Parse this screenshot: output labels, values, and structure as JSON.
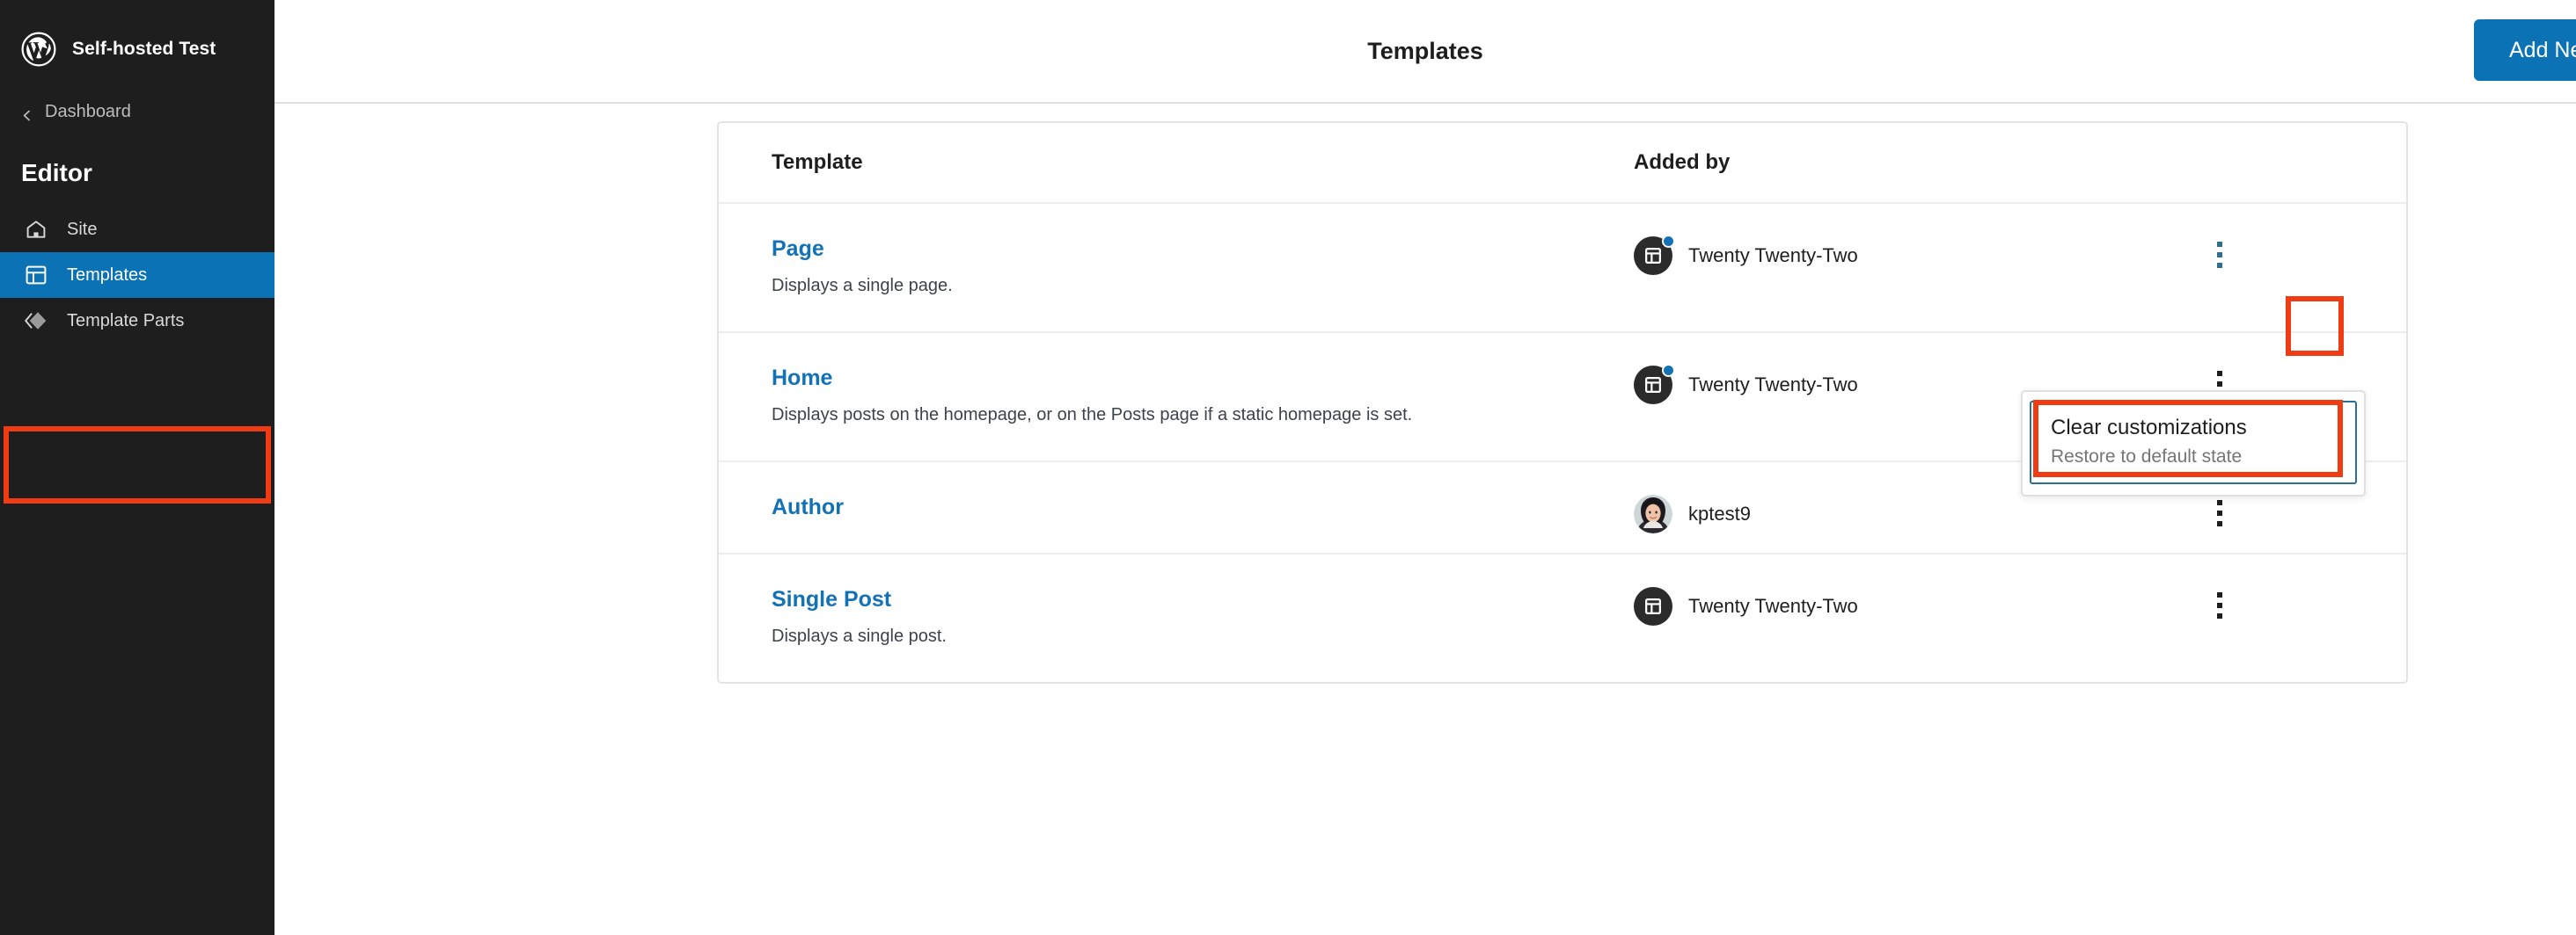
{
  "sidebar": {
    "logo_icon": "wordpress-logo-icon",
    "brand_title": "Self-hosted Test",
    "back_link": {
      "label": "Dashboard",
      "icon": "chevron-left-icon"
    },
    "section_heading": "Editor",
    "items": [
      {
        "label": "Site",
        "icon": "home-icon",
        "active": false
      },
      {
        "label": "Templates",
        "icon": "layout-icon",
        "active": true
      },
      {
        "label": "Template Parts",
        "icon": "template-part-icon",
        "active": false
      }
    ]
  },
  "header": {
    "title": "Templates",
    "add_new_label": "Add New"
  },
  "table": {
    "columns": {
      "template": "Template",
      "added_by": "Added by"
    },
    "rows": [
      {
        "name": "Page",
        "description": "Displays a single page.",
        "added_by": "Twenty Twenty-Two",
        "avatar_type": "theme-layout-icon",
        "customized": true,
        "menu_icon": "kebab-menu-icon",
        "menu_active": true
      },
      {
        "name": "Home",
        "description": "Displays posts on the homepage, or on the Posts page if a static homepage is set.",
        "added_by": "Twenty Twenty-Two",
        "avatar_type": "theme-layout-icon",
        "customized": true,
        "menu_icon": "kebab-menu-icon",
        "menu_active": false
      },
      {
        "name": "Author",
        "description": "",
        "added_by": "kptest9",
        "avatar_type": "user-photo",
        "customized": false,
        "menu_icon": "kebab-menu-icon",
        "menu_active": false
      },
      {
        "name": "Single Post",
        "description": "Displays a single post.",
        "added_by": "Twenty Twenty-Two",
        "avatar_type": "theme-layout-icon",
        "customized": false,
        "menu_icon": "kebab-menu-icon",
        "menu_active": false
      }
    ]
  },
  "dropdown": {
    "item_label": "Clear customizations",
    "item_sublabel": "Restore to default state"
  },
  "colors": {
    "sidebar_bg": "#1e1e1e",
    "accent_blue": "#0b72b5",
    "link_blue": "#1272b5",
    "annotation_red": "#f03c14",
    "focus_outline": "#2a6f92"
  }
}
